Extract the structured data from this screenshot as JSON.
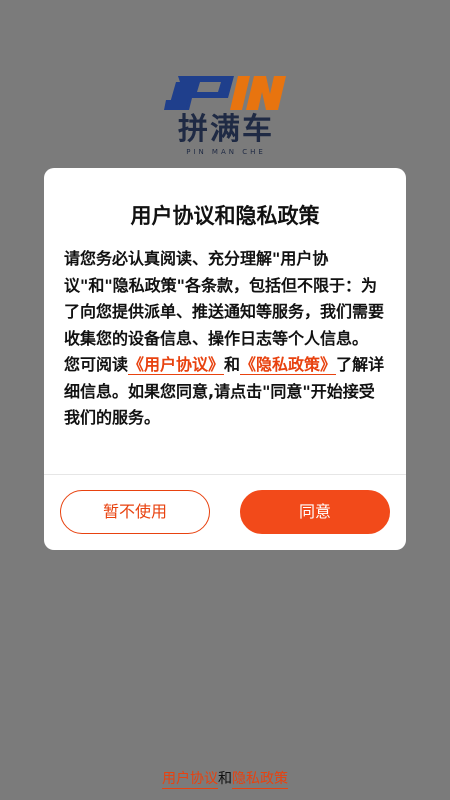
{
  "brand": {
    "logo_letters": "PIN",
    "name": "拼满车",
    "subtitle": "PIN MAN CHE",
    "colors": {
      "blue": "#1f3f8c",
      "orange": "#e8740f"
    }
  },
  "dialog": {
    "title": "用户协议和隐私政策",
    "paragraph1": "请您务必认真阅读、充分理解\"用户协议\"和\"隐私政策\"各条款，包括但不限于：为了向您提供派单、推送通知等服务，我们需要收集您的设备信息、操作日志等个人信息。",
    "p2_prefix": "您可阅读",
    "p2_user_agreement": "《用户协议》",
    "p2_and": "和",
    "p2_privacy_policy": "《隐私政策》",
    "p2_suffix": "了解详细信息。如果您同意,请点击\"同意\"开始接受我们的服务。",
    "decline_label": "暂不使用",
    "agree_label": "同意"
  },
  "footer": {
    "user_agreement": "用户协议",
    "and": "和",
    "privacy_policy": "隐私政策"
  },
  "colors": {
    "accent": "#f24a1a",
    "overlay": "#7b7b7b",
    "dialog_bg": "#ffffff"
  }
}
